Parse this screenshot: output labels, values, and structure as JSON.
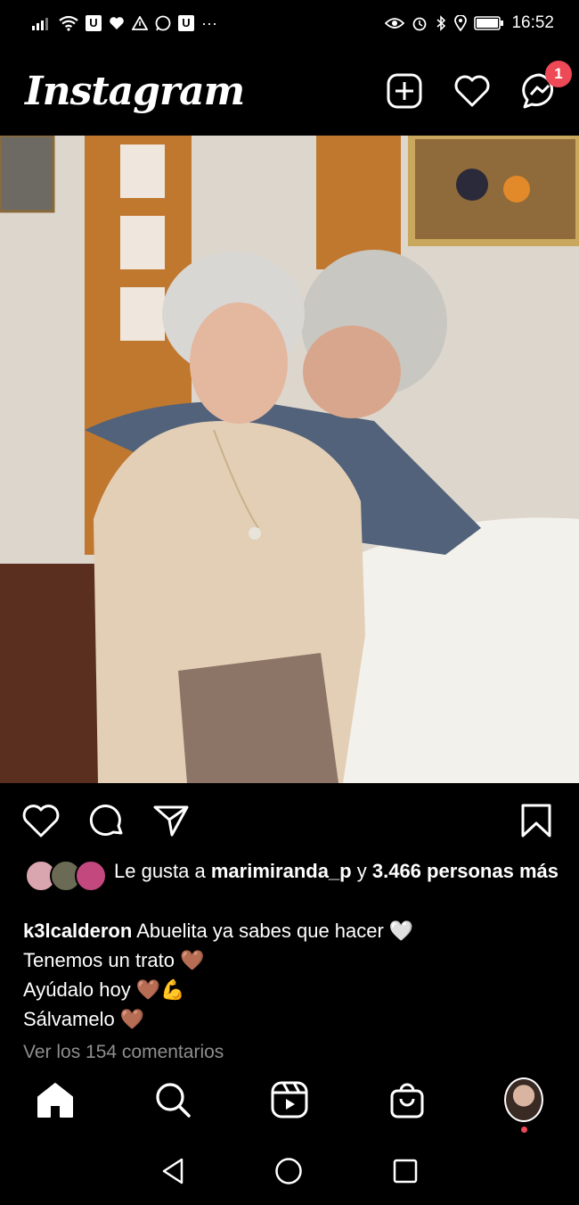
{
  "status_bar": {
    "time": "16:52",
    "more": "···"
  },
  "app": {
    "title": "Instagram",
    "notification_count": "1"
  },
  "post": {
    "likes_prefix": "Le gusta a",
    "likes_user": "marimiranda_p",
    "likes_joiner": "y",
    "likes_count": "3.466 personas más",
    "caption_user": "k3lcalderon",
    "caption_line1": "Abuelita ya sabes que hacer 🤍",
    "caption_line2": "Tenemos un trato 🤎",
    "caption_line3": "Ayúdalo hoy 🤎💪",
    "caption_line4": "Sálvamelo 🤎",
    "view_comments": "Ver los 154 comentarios"
  },
  "icons": {
    "header": [
      "new-post-icon",
      "heart-icon",
      "messenger-icon"
    ],
    "actions": [
      "like-icon",
      "comment-icon",
      "share-icon",
      "save-icon"
    ],
    "nav": [
      "home-icon",
      "search-icon",
      "reels-icon",
      "shop-icon",
      "profile-avatar"
    ]
  }
}
